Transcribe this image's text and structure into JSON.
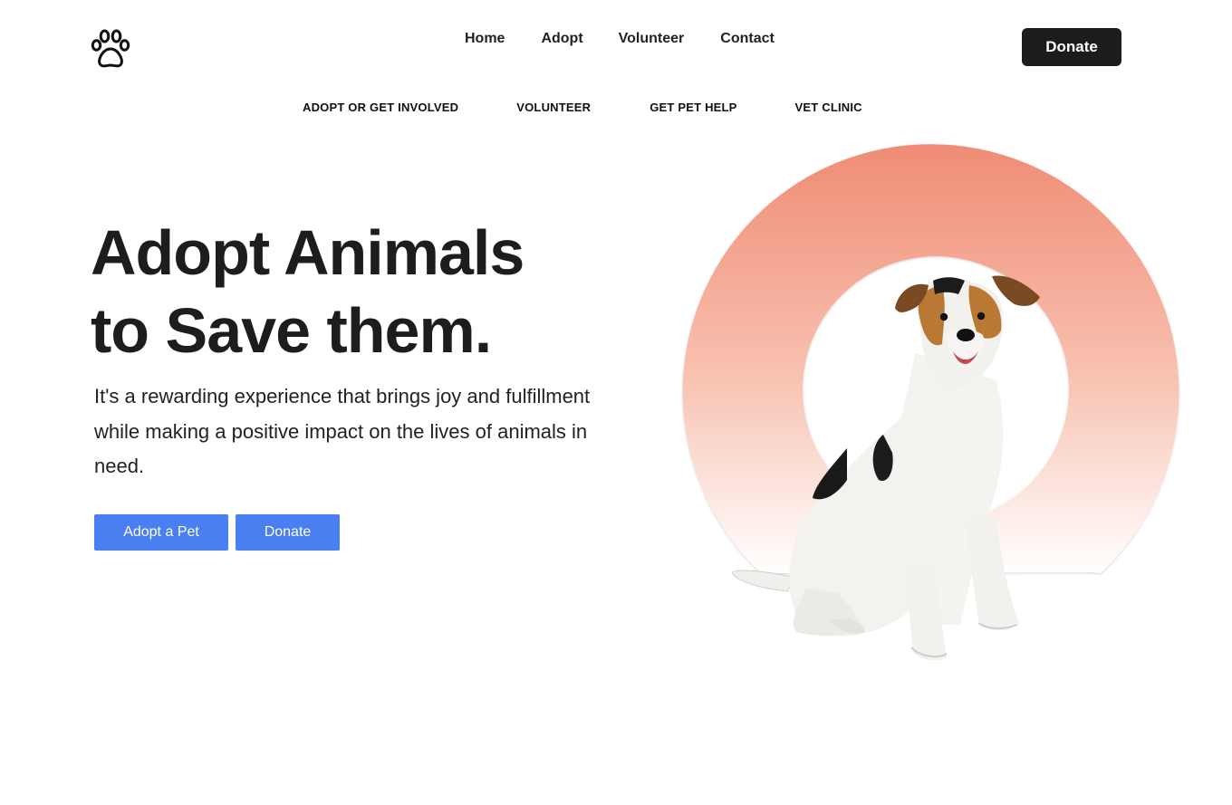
{
  "header": {
    "logo": "paw-icon",
    "nav": [
      "Home",
      "Adopt",
      "Volunteer",
      "Contact"
    ],
    "donate_label": "Donate"
  },
  "subnav": [
    "ADOPT OR GET INVOLVED",
    "VOLUNTEER",
    "GET PET HELP",
    "VET CLINIC"
  ],
  "hero": {
    "title_line1": "Adopt Animals",
    "title_line2": "to Save them.",
    "description": "It's a rewarding experience that brings joy and fulfillment while making a positive impact on the lives of animals in need.",
    "primary_button": "Adopt a Pet",
    "secondary_button": "Donate",
    "image": "dog-photo"
  },
  "colors": {
    "accent": "#4a7ff1",
    "dark_button": "#1c1c1c",
    "gradient_top": "#f08c75",
    "gradient_bottom": "#ffffff"
  }
}
